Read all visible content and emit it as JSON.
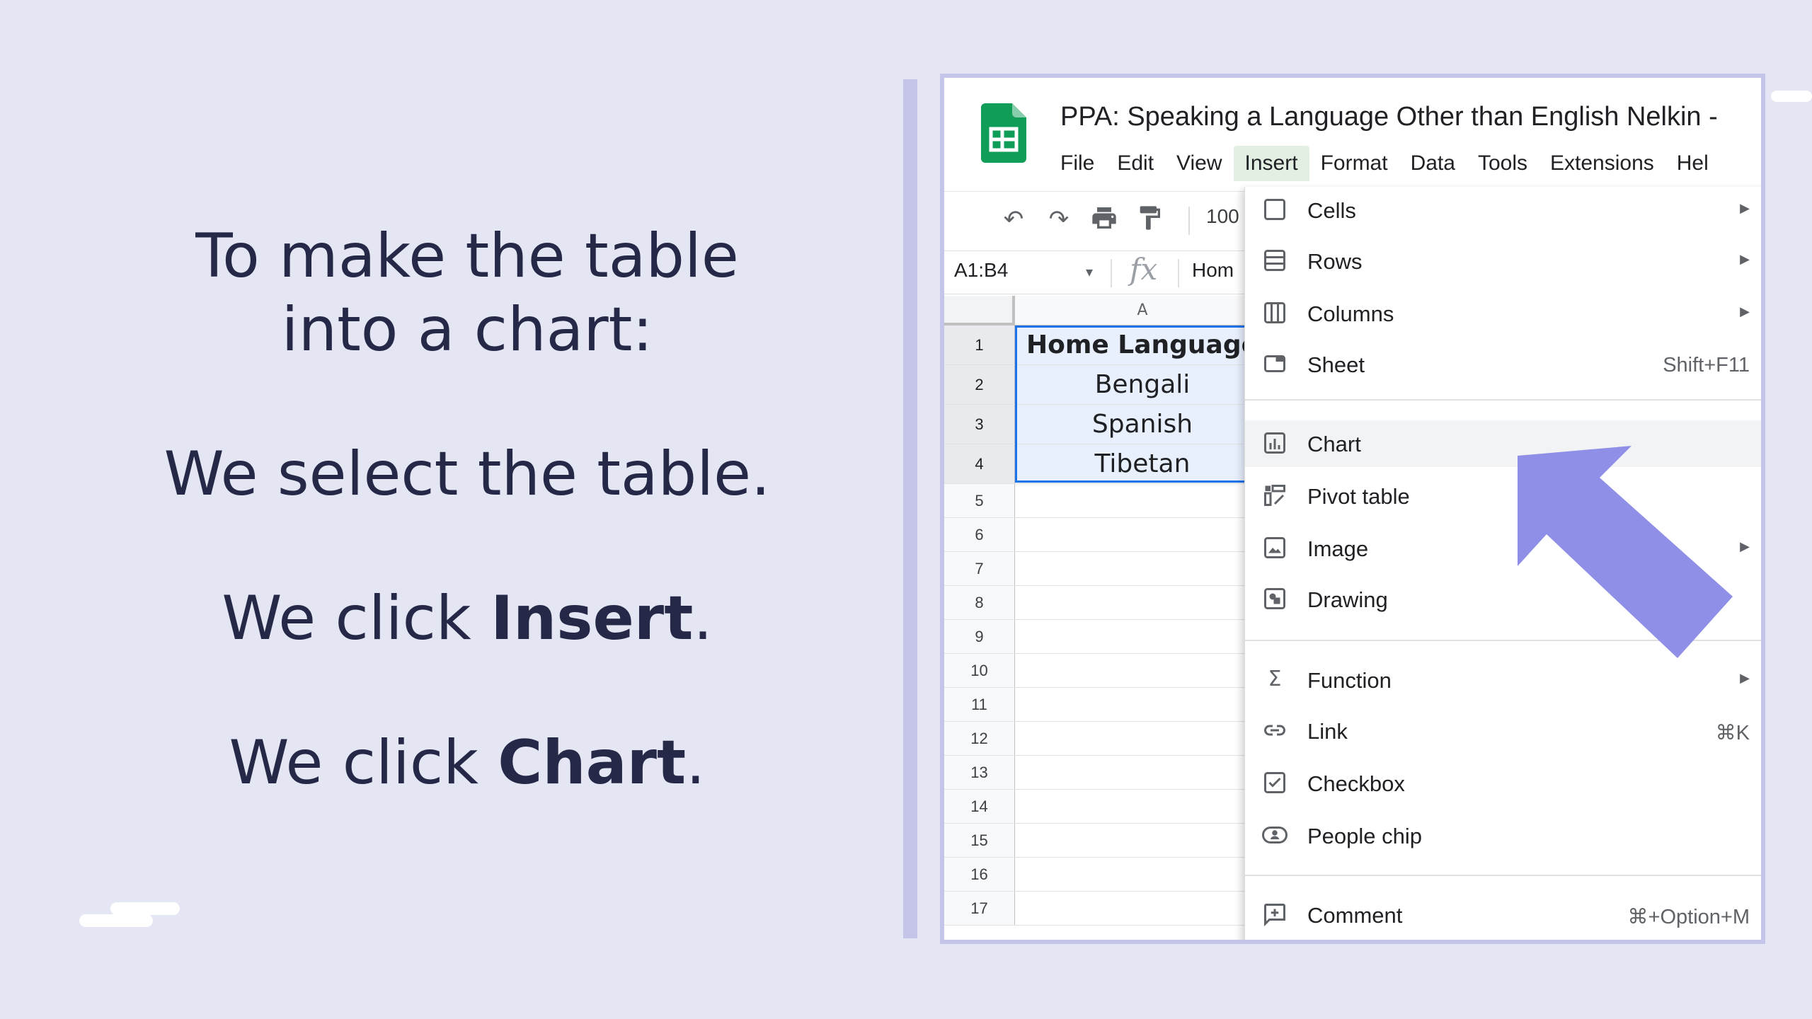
{
  "instructions": {
    "line1": "To make the table",
    "line2": "into a chart:",
    "line3": "We select the table.",
    "line4_pre": "We click ",
    "line4_bold": "Insert",
    "line4_post": ".",
    "line5_pre": "We click ",
    "line5_bold": "Chart",
    "line5_post": "."
  },
  "app": {
    "title": "PPA: Speaking a Language Other than English Nelkin -",
    "menus": [
      "File",
      "Edit",
      "View",
      "Insert",
      "Format",
      "Data",
      "Tools",
      "Extensions",
      "Hel"
    ],
    "active_menu": "Insert",
    "zoom": "100",
    "name_box": "A1:B4",
    "formula_value": "Hom"
  },
  "grid": {
    "column": "A",
    "rows": [
      {
        "num": "1",
        "value": "Home Language"
      },
      {
        "num": "2",
        "value": "Bengali"
      },
      {
        "num": "3",
        "value": "Spanish"
      },
      {
        "num": "4",
        "value": "Tibetan"
      },
      {
        "num": "5",
        "value": ""
      },
      {
        "num": "6",
        "value": ""
      },
      {
        "num": "7",
        "value": ""
      },
      {
        "num": "8",
        "value": ""
      },
      {
        "num": "9",
        "value": ""
      },
      {
        "num": "10",
        "value": ""
      },
      {
        "num": "11",
        "value": ""
      },
      {
        "num": "12",
        "value": ""
      },
      {
        "num": "13",
        "value": ""
      },
      {
        "num": "14",
        "value": ""
      },
      {
        "num": "15",
        "value": ""
      },
      {
        "num": "16",
        "value": ""
      },
      {
        "num": "17",
        "value": ""
      }
    ]
  },
  "insert_menu": {
    "items": [
      {
        "label": "Cells",
        "icon": "cells-icon",
        "shortcut": "",
        "submenu": true
      },
      {
        "label": "Rows",
        "icon": "rows-icon",
        "shortcut": "",
        "submenu": true
      },
      {
        "label": "Columns",
        "icon": "columns-icon",
        "shortcut": "",
        "submenu": true
      },
      {
        "label": "Sheet",
        "icon": "sheet-icon",
        "shortcut": "Shift+F11",
        "submenu": false
      },
      {
        "label": "Chart",
        "icon": "chart-icon",
        "shortcut": "",
        "submenu": false,
        "highlighted": true
      },
      {
        "label": "Pivot table",
        "icon": "pivot-table-icon",
        "shortcut": "",
        "submenu": false
      },
      {
        "label": "Image",
        "icon": "image-icon",
        "shortcut": "",
        "submenu": true
      },
      {
        "label": "Drawing",
        "icon": "drawing-icon",
        "shortcut": "",
        "submenu": false
      },
      {
        "label": "Function",
        "icon": "function-icon",
        "shortcut": "",
        "submenu": true
      },
      {
        "label": "Link",
        "icon": "link-icon",
        "shortcut": "⌘K",
        "submenu": false
      },
      {
        "label": "Checkbox",
        "icon": "checkbox-icon",
        "shortcut": "",
        "submenu": false
      },
      {
        "label": "People chip",
        "icon": "people-chip-icon",
        "shortcut": "",
        "submenu": false
      },
      {
        "label": "Comment",
        "icon": "comment-icon",
        "shortcut": "⌘+Option+M",
        "submenu": false
      }
    ]
  },
  "colors": {
    "background": "#e4e6f3",
    "accent_purple": "#8f8fe8",
    "selection_blue": "#1a73e8",
    "sheets_green": "#0f9d58"
  }
}
